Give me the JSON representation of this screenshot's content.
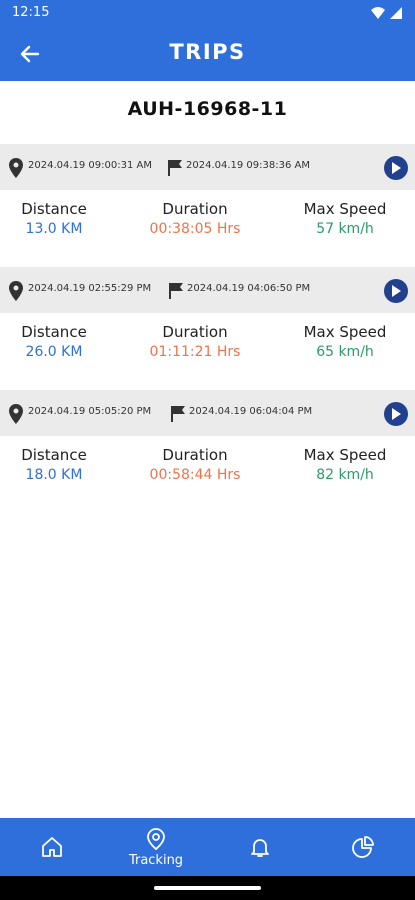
{
  "status": {
    "time": "12:15"
  },
  "header": {
    "title": "TRIPS"
  },
  "vehicle": {
    "plate": "AUH-16968-11"
  },
  "labels": {
    "distance": "Distance",
    "duration": "Duration",
    "max_speed": "Max Speed"
  },
  "trips": [
    {
      "start": "2024.04.19 09:00:31 AM",
      "end": "2024.04.19 09:38:36 AM",
      "distance": "13.0 KM",
      "duration": "00:38:05 Hrs",
      "max_speed": "57 km/h"
    },
    {
      "start": "2024.04.19 02:55:29 PM",
      "end": "2024.04.19 04:06:50 PM",
      "distance": "26.0 KM",
      "duration": "01:11:21 Hrs",
      "max_speed": "65 km/h"
    },
    {
      "start": "2024.04.19 05:05:20 PM",
      "end": "2024.04.19 06:04:04 PM",
      "distance": "18.0 KM",
      "duration": "00:58:44 Hrs",
      "max_speed": "82 km/h"
    }
  ],
  "nav": [
    {
      "icon": "home-icon",
      "label": ""
    },
    {
      "icon": "location-pin-icon",
      "label": "Tracking"
    },
    {
      "icon": "bell-icon",
      "label": ""
    },
    {
      "icon": "pie-chart-icon",
      "label": ""
    }
  ],
  "colors": {
    "primary": "#2f6fdc",
    "play_button": "#21408e",
    "distance": "#2f6fdc",
    "duration": "#f0724a",
    "speed": "#2e9a68"
  }
}
